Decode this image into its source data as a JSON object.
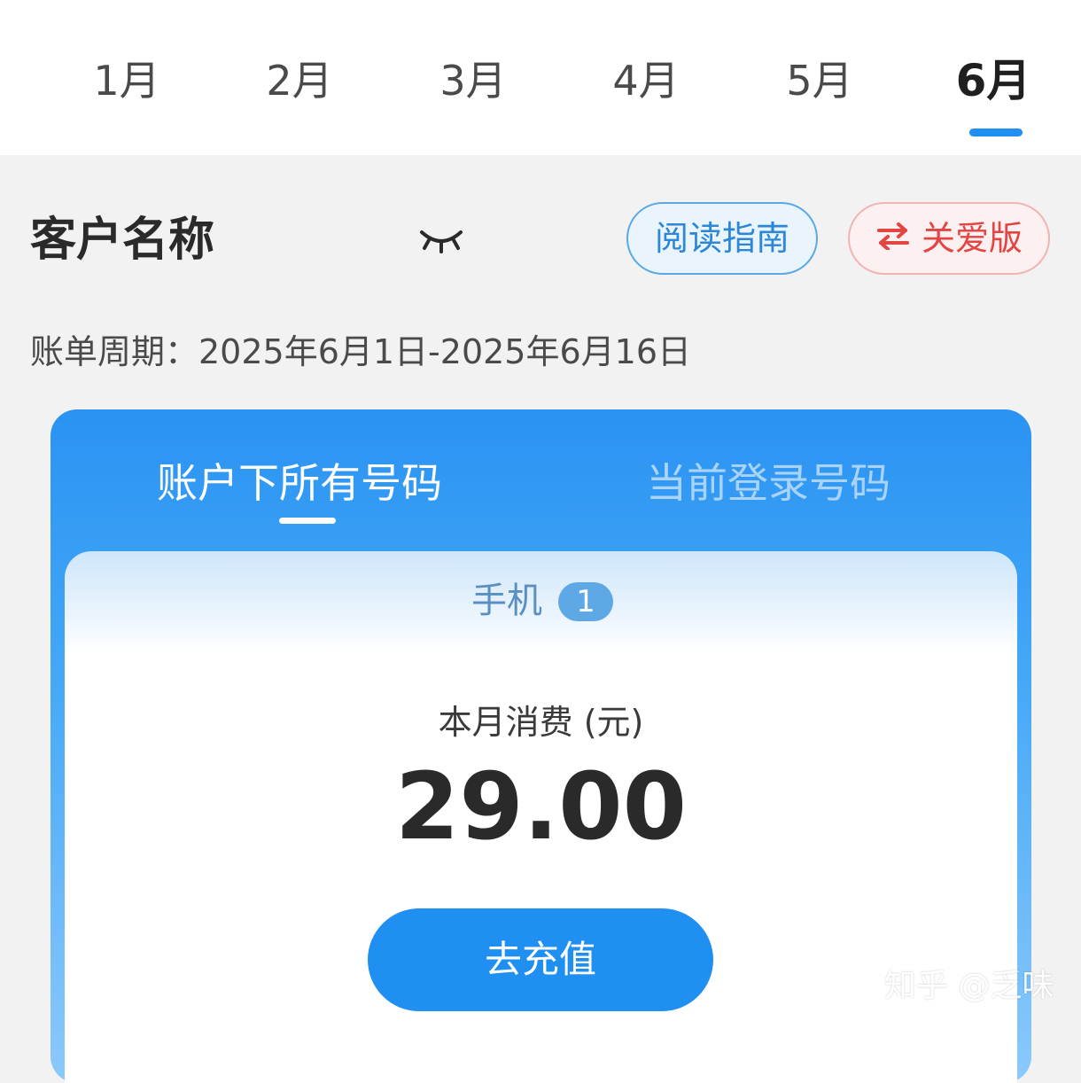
{
  "months": {
    "items": [
      {
        "label": "1月"
      },
      {
        "label": "2月"
      },
      {
        "label": "3月"
      },
      {
        "label": "4月"
      },
      {
        "label": "5月"
      },
      {
        "label": "6月"
      }
    ],
    "active": "6月"
  },
  "customer": {
    "name": "客户名称",
    "eye_icon": "eye-closed-icon"
  },
  "actions": {
    "guide_label": "阅读指南",
    "care_label": "关爱版",
    "care_icon": "swap-arrows-icon"
  },
  "bill": {
    "period_text": "账单周期：2025年6月1日-2025年6月16日"
  },
  "card": {
    "tabs": [
      {
        "label": "账户下所有号码"
      },
      {
        "label": "当前登录号码"
      }
    ],
    "active_tab": "账户下所有号码",
    "phone_label": "手机",
    "phone_count": "1",
    "spend_label": "本月消费 (元)",
    "spend_value": "29.00",
    "recharge_label": "去充值"
  },
  "colors": {
    "accent_blue": "#1f8ff2",
    "care_red": "#e34444",
    "guide_blue": "#2d86d6"
  },
  "watermark": "知乎 @乏味"
}
